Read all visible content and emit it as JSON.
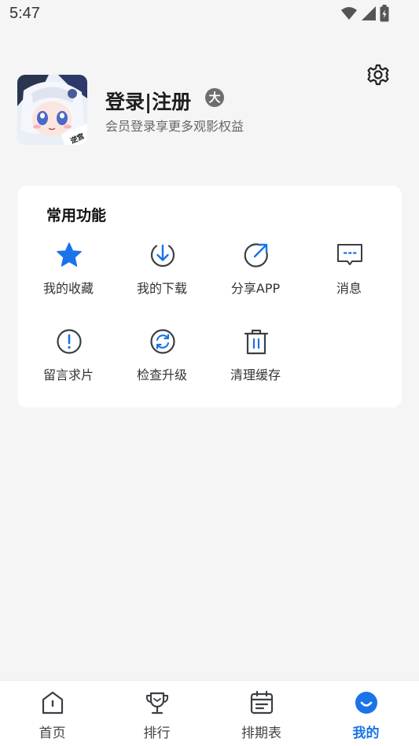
{
  "status_bar": {
    "time": "5:47"
  },
  "profile": {
    "title": "登录|注册",
    "badge": "大",
    "subtitle": "会员登录享更多观影权益",
    "avatar_text": "逆宫"
  },
  "functions": {
    "title": "常用功能",
    "items": [
      {
        "label": "我的收藏",
        "icon": "star-icon"
      },
      {
        "label": "我的下载",
        "icon": "download-icon"
      },
      {
        "label": "分享APP",
        "icon": "share-icon"
      },
      {
        "label": "消息",
        "icon": "message-icon"
      },
      {
        "label": "留言求片",
        "icon": "feedback-icon"
      },
      {
        "label": "检查升级",
        "icon": "refresh-icon"
      },
      {
        "label": "清理缓存",
        "icon": "trash-icon"
      }
    ]
  },
  "bottom_nav": {
    "items": [
      {
        "label": "首页",
        "icon": "home-icon"
      },
      {
        "label": "排行",
        "icon": "trophy-icon"
      },
      {
        "label": "排期表",
        "icon": "calendar-icon"
      },
      {
        "label": "我的",
        "icon": "profile-icon",
        "active": true
      }
    ]
  },
  "colors": {
    "accent": "#1a73e8",
    "background": "#f5f5f6",
    "icon": "#3b3f45"
  }
}
